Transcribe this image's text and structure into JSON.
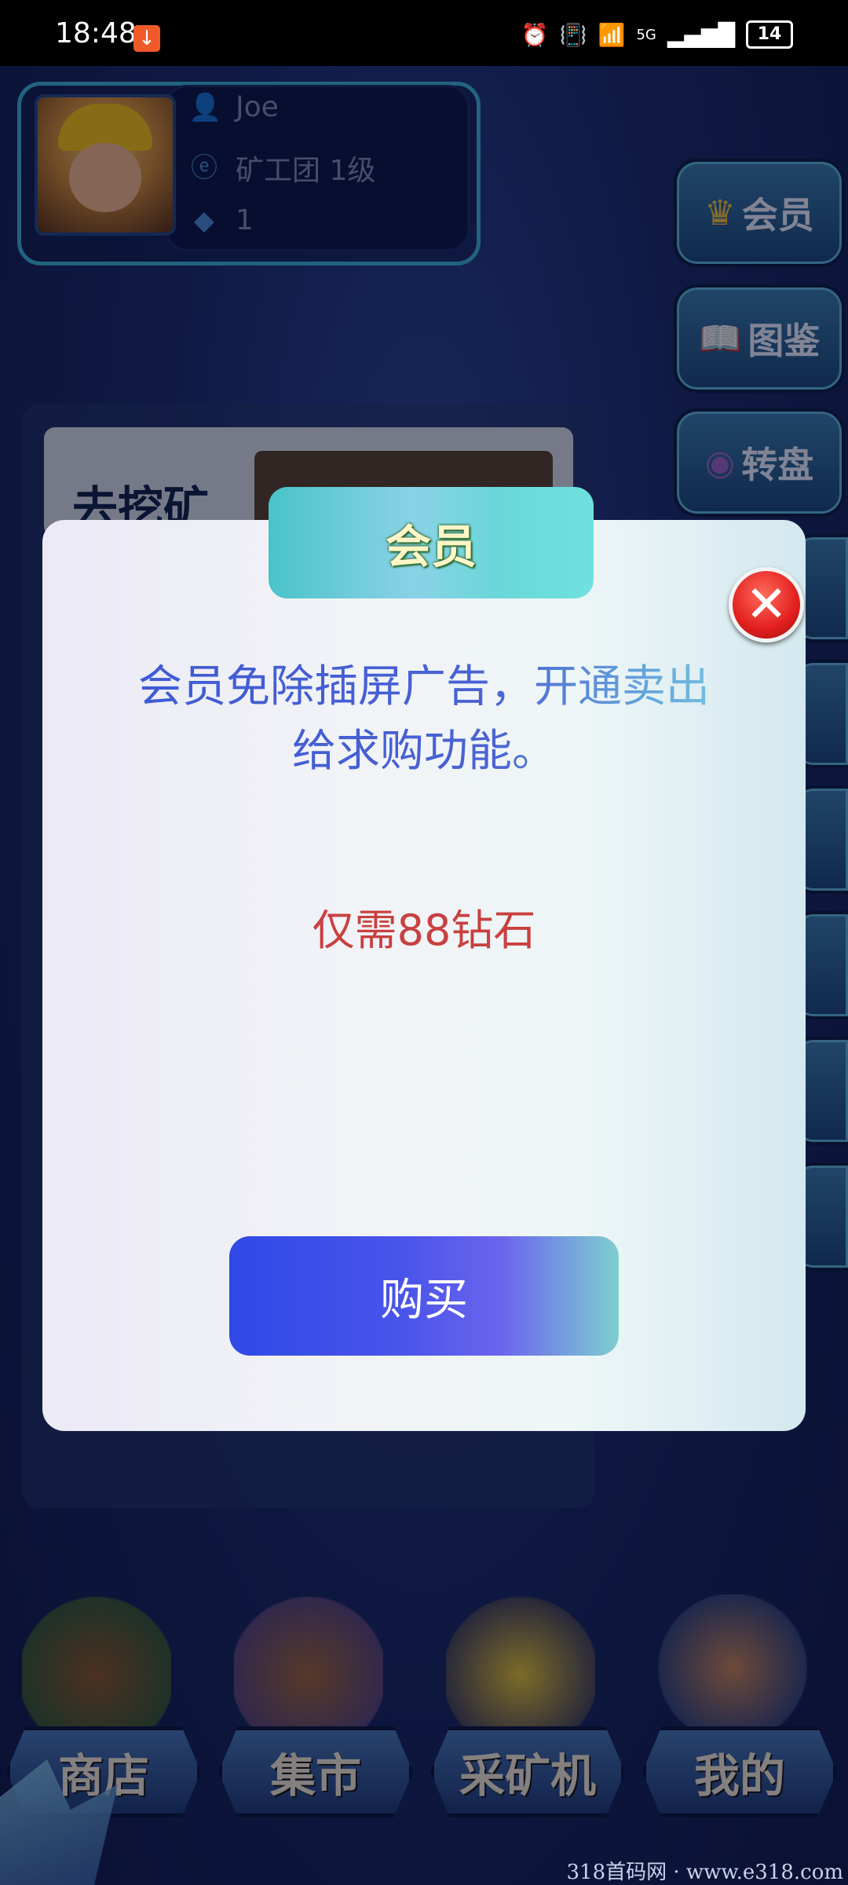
{
  "status_bar": {
    "time": "18:48",
    "network": "5G",
    "battery": "14",
    "icons": [
      "download-icon",
      "alarm-icon",
      "vibrate-icon",
      "wifi-icon",
      "signal-icon",
      "battery-icon"
    ]
  },
  "profile": {
    "name": "Joe",
    "guild": "矿工团  1级",
    "diamonds": "1"
  },
  "side_menu": [
    {
      "label": "会员",
      "icon": "crown-icon"
    },
    {
      "label": "图鉴",
      "icon": "book-icon"
    },
    {
      "label": "转盘",
      "icon": "wheel-icon"
    }
  ],
  "background_card": {
    "title": "去挖矿"
  },
  "modal": {
    "title": "会员",
    "description_line1": "会员免除插屏广告，开通卖出",
    "description_line2": "给求购功能。",
    "price": "仅需88钻石",
    "buy_label": "购买"
  },
  "bottom_nav": [
    {
      "label": "商店",
      "icon": "shop-icon"
    },
    {
      "label": "集市",
      "icon": "market-icon"
    },
    {
      "label": "采矿机",
      "icon": "mining-machine-icon"
    },
    {
      "label": "我的",
      "icon": "profile-character-icon"
    }
  ],
  "watermark": "318首码网 · www.e318.com",
  "colors": {
    "modal_title_gradient": "#49c3c9",
    "description": "#3d5ad6",
    "price": "#c94040",
    "buy_button": "#2f49e6",
    "close_button": "#e21f1f"
  }
}
